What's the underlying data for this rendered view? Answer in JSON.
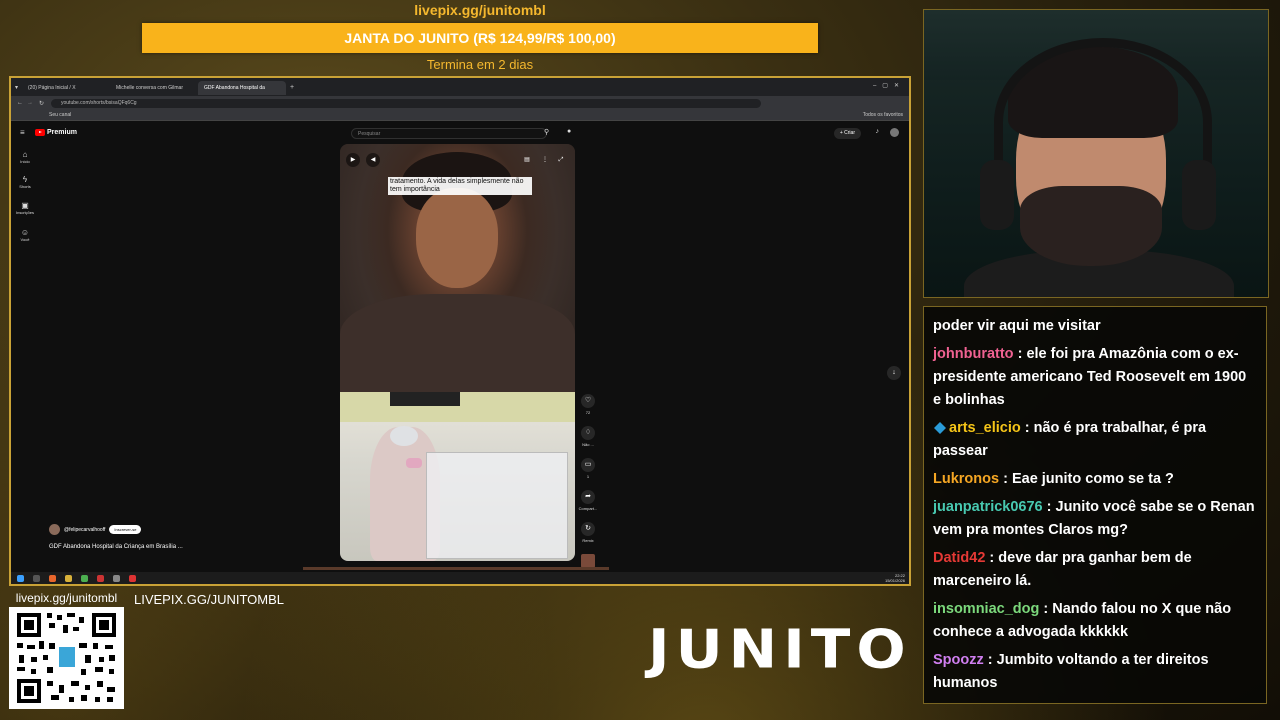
{
  "overlay": {
    "goal_title": "livepix.gg/junitombl",
    "goal_bar_text": "JANTA DO JUNITO (R$ 124,99/R$ 100,00)",
    "goal_progress": 1.0,
    "goal_color": "#f9b31b",
    "goal_sub": "Termina em 2 dias",
    "qr_label": "livepix.gg/junitombl",
    "livepix_text": "LIVEPIX.GG/JUNITOMBL",
    "logo_text": "JUNITO"
  },
  "browser": {
    "tabs": [
      {
        "label": "(20) Página Inicial / X",
        "active": false
      },
      {
        "label": "Michelle conversa com Gilmar",
        "active": false
      },
      {
        "label": "GDF Abandona Hospital da",
        "active": true
      }
    ],
    "url": "youtube.com/shorts/bsisaQFq6Cg",
    "bookmark_channel": "Seu canal",
    "bookmarks_right": "Todos os favoritos"
  },
  "youtube": {
    "logo_label": "Premium",
    "search_placeholder": "Pesquisar",
    "create_label": "Criar",
    "sidebar": [
      {
        "icon": "home-icon",
        "label": "Início"
      },
      {
        "icon": "shorts-icon",
        "label": "Shorts"
      },
      {
        "icon": "subscriptions-icon",
        "label": "Inscrições"
      },
      {
        "icon": "you-icon",
        "label": "Você"
      }
    ],
    "caption": "tratamento. A vida delas simplesmente não tem importância",
    "actions": [
      {
        "icon": "like-icon",
        "label": "72"
      },
      {
        "icon": "dislike-icon",
        "label": "Não ..."
      },
      {
        "icon": "comments-icon",
        "label": "1"
      },
      {
        "icon": "share-icon",
        "label": "Compart..."
      },
      {
        "icon": "remix-icon",
        "label": "Remix"
      }
    ],
    "channel": "@felipecarvalhooff",
    "subscribe_label": "Inscrever-se",
    "video_title": "GDF Abandona Hospital da Criança em Brasília ..."
  },
  "taskbar": {
    "time": "22:22",
    "date": "15/01/2026"
  },
  "chat": [
    {
      "user": "",
      "color": "#ffffff",
      "text": "poder vir aqui me visitar",
      "badge": false
    },
    {
      "user": "johnburatto",
      "color": "#f06292",
      "text": "ele foi pra Amazônia com o ex-presidente americano Ted Roosevelt em 1900 e bolinhas",
      "badge": false
    },
    {
      "user": "arts_elicio",
      "color": "#f5c518",
      "text": "não é pra trabalhar, é pra passear",
      "badge": true
    },
    {
      "user": "Lukronos",
      "color": "#f5a623",
      "text": "Eae junito como se ta ?",
      "badge": false
    },
    {
      "user": "juanpatrick0676",
      "color": "#48c9b0",
      "text": "Junito você sabe se o Renan vem pra montes Claros mg?",
      "badge": false
    },
    {
      "user": "Datid42",
      "color": "#e53935",
      "text": "deve dar pra ganhar bem de marceneiro lá.",
      "badge": false
    },
    {
      "user": "insomniac_dog",
      "color": "#7cd97c",
      "text": "Nando falou no X que não conhece a advogada kkkkkk",
      "badge": false
    },
    {
      "user": "Spoozz",
      "color": "#d07ff0",
      "text": "Jumbito voltando a ter direitos humanos",
      "badge": false
    }
  ]
}
